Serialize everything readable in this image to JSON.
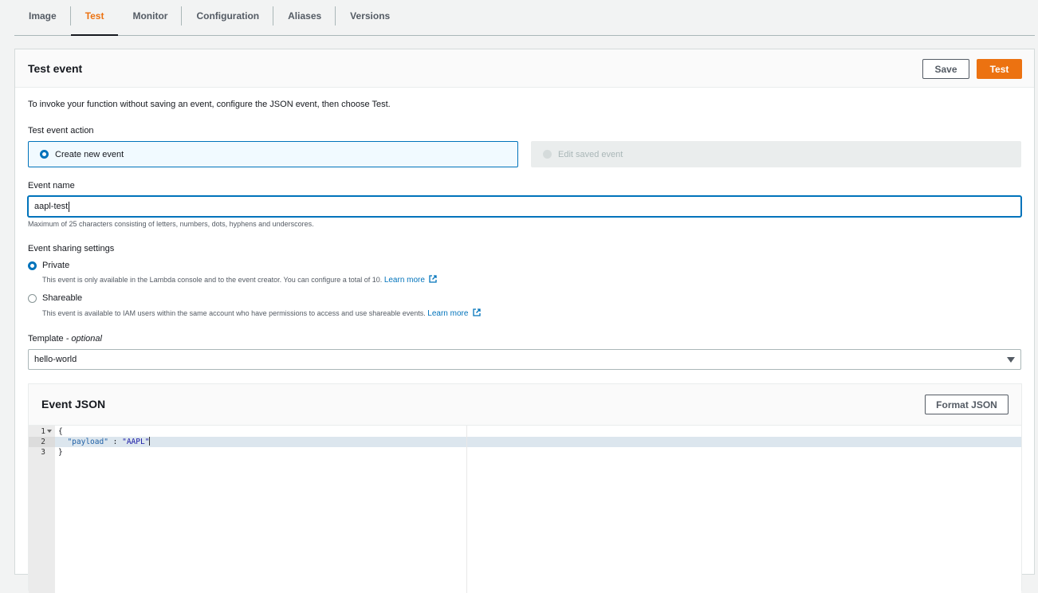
{
  "tabs": [
    "Image",
    "Test",
    "Monitor",
    "Configuration",
    "Aliases",
    "Versions"
  ],
  "active_tab": "Test",
  "panel": {
    "title": "Test event",
    "save_label": "Save",
    "test_label": "Test"
  },
  "intro": "To invoke your function without saving an event, configure the JSON event, then choose Test.",
  "test_event_action": {
    "label": "Test event action",
    "options": [
      "Create new event",
      "Edit saved event"
    ],
    "selected": "Create new event"
  },
  "event_name": {
    "label": "Event name",
    "value": "aapl-test",
    "hint": "Maximum of 25 characters consisting of letters, numbers, dots, hyphens and underscores."
  },
  "sharing": {
    "label": "Event sharing settings",
    "private_label": "Private",
    "private_desc": "This event is only available in the Lambda console and to the event creator. You can configure a total of 10.",
    "shareable_label": "Shareable",
    "shareable_desc": "This event is available to IAM users within the same account who have permissions to access and use shareable events.",
    "learn_more": "Learn more",
    "selected": "Private"
  },
  "template": {
    "label": "Template",
    "label_suffix": "- optional",
    "value": "hello-world"
  },
  "event_json": {
    "title": "Event JSON",
    "format_label": "Format JSON",
    "line_numbers": [
      "1",
      "2",
      "3"
    ],
    "lines": {
      "l1": "{",
      "l2_key": "\"payload\"",
      "l2_sep": " : ",
      "l2_val": "\"AAPL\"",
      "l3": "}"
    },
    "active_line": 2
  },
  "colors": {
    "accent": "#ec7211",
    "link": "#0073bb",
    "text": "#16191f"
  }
}
